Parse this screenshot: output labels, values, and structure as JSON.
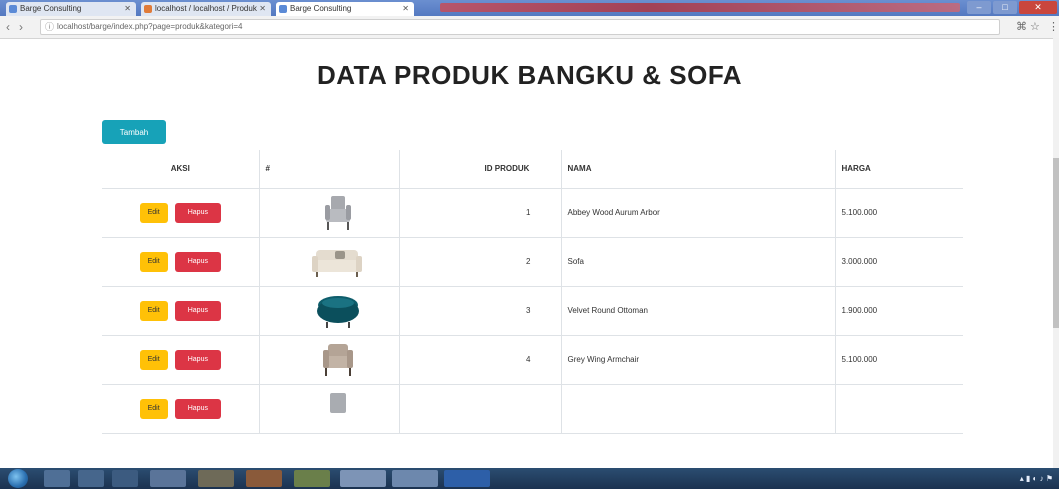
{
  "browser": {
    "tabs": [
      {
        "title": "Barge Consulting"
      },
      {
        "title": "localhost / localhost / Produk"
      },
      {
        "title": "Barge Consulting"
      }
    ],
    "url": "localhost/barge/index.php?page=produk&kategori=4"
  },
  "page": {
    "title": "DATA PRODUK BANGKU & SOFA",
    "add_button": "Tambah",
    "columns": {
      "aksi": "AKSI",
      "no": "#",
      "id_produk": "ID PRODUK",
      "nama": "NAMA",
      "harga": "HARGA"
    },
    "edit_label": "Edit",
    "hapus_label": "Hapus",
    "rows": [
      {
        "no": "1",
        "nama": "Abbey Wood Aurum Arbor",
        "harga": "5.100.000",
        "image": "armchair-gray"
      },
      {
        "no": "2",
        "nama": "Sofa",
        "harga": "3.000.000",
        "image": "sofa-cream"
      },
      {
        "no": "3",
        "nama": "Velvet Round Ottoman",
        "harga": "1.900.000",
        "image": "ottoman-teal"
      },
      {
        "no": "4",
        "nama": "Grey Wing Armchair",
        "harga": "5.100.000",
        "image": "armchair-taupe"
      }
    ]
  },
  "colors": {
    "add_button": "#17a2b8",
    "edit_button": "#ffc107",
    "hapus_button": "#dc3545",
    "tabbar": "#5479c1",
    "taskbar": "#1b3250"
  }
}
